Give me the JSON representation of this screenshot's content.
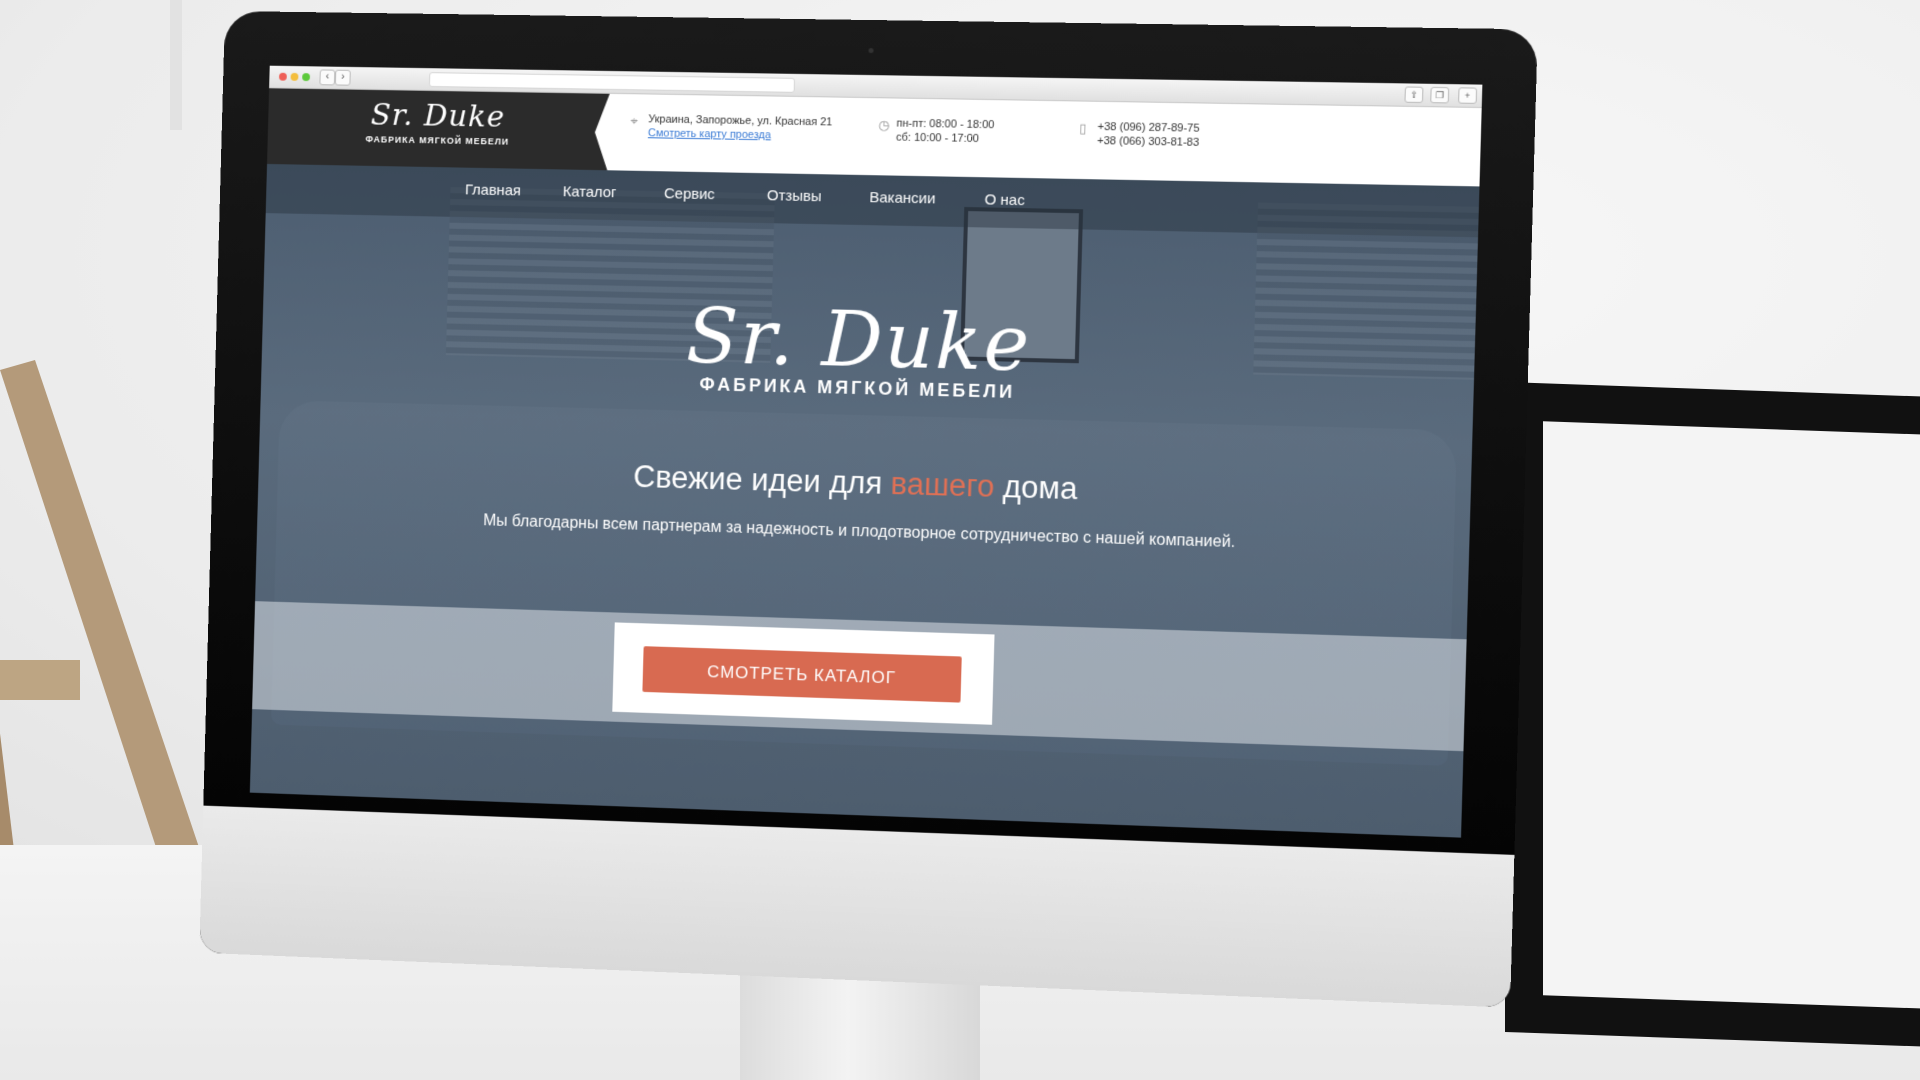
{
  "colors": {
    "accent": "#d86a51",
    "hero_bg": "#4f6073",
    "dark_header": "#2b2b2b"
  },
  "header": {
    "logo_script": "Sr. Duke",
    "logo_sub": "ФАБРИКА МЯГКОЙ МЕБЕЛИ",
    "address": "Украина, Запорожье, ул. Красная 21",
    "map_link": "Смотреть карту проезда",
    "hours_weekdays": "пн-пт: 08:00 - 18:00",
    "hours_saturday": "сб: 10:00 - 17:00",
    "phone1": "+38 (096) 287-89-75",
    "phone2": "+38 (066) 303-81-83",
    "icons": {
      "address": "map-pin-icon",
      "hours": "clock-icon",
      "phone": "phone-icon"
    }
  },
  "nav": {
    "items": [
      {
        "label": "Главная"
      },
      {
        "label": "Каталог"
      },
      {
        "label": "Сервис"
      },
      {
        "label": "Отзывы"
      },
      {
        "label": "Вакансии"
      },
      {
        "label": "О нас"
      }
    ]
  },
  "hero": {
    "logo_script": "Sr. Duke",
    "logo_sub": "ФАБРИКА МЯГКОЙ МЕБЕЛИ",
    "title_before": "Свежие идеи для ",
    "title_accent": "вашего",
    "title_after": " дома",
    "text": "Мы благодарны всем партнерам за надежность и плодотворное сотрудничество с нашей компанией.",
    "cta": "СМОТРЕТЬ КАТАЛОГ"
  }
}
